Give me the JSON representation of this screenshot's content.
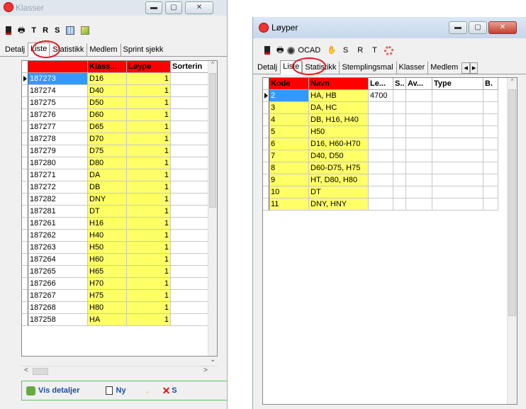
{
  "klasser": {
    "title": "Klasser",
    "toolbar": [
      "T",
      "R",
      "S"
    ],
    "tabs": [
      "Detalj",
      "Liste",
      "Statistikk",
      "Medlem",
      "Sprint sjekk"
    ],
    "columns": [
      "",
      "Klass...",
      "Løype",
      "Sorterin"
    ],
    "rows": [
      [
        "187273",
        "D16",
        "1"
      ],
      [
        "187274",
        "D40",
        "1"
      ],
      [
        "187275",
        "D50",
        "1"
      ],
      [
        "187276",
        "D60",
        "1"
      ],
      [
        "187277",
        "D65",
        "1"
      ],
      [
        "187278",
        "D70",
        "1"
      ],
      [
        "187279",
        "D75",
        "1"
      ],
      [
        "187280",
        "D80",
        "1"
      ],
      [
        "187271",
        "DA",
        "1"
      ],
      [
        "187272",
        "DB",
        "1"
      ],
      [
        "187282",
        "DNY",
        "1"
      ],
      [
        "187281",
        "DT",
        "1"
      ],
      [
        "187261",
        "H16",
        "1"
      ],
      [
        "187262",
        "H40",
        "1"
      ],
      [
        "187263",
        "H50",
        "1"
      ],
      [
        "187264",
        "H60",
        "1"
      ],
      [
        "187265",
        "H65",
        "1"
      ],
      [
        "187266",
        "H70",
        "1"
      ],
      [
        "187267",
        "H75",
        "1"
      ],
      [
        "187268",
        "H80",
        "1"
      ],
      [
        "187258",
        "HA",
        "1"
      ]
    ],
    "buttons": {
      "details": "Vis detaljer",
      "new": "Ny",
      "delete": "S"
    }
  },
  "loyper": {
    "title": "Løyper",
    "toolbar": [
      "OCAD",
      "S",
      "R",
      "T"
    ],
    "tabs": [
      "Detalj",
      "Liste",
      "Statistikk",
      "Stemplingsmal",
      "Klasser",
      "Medlem"
    ],
    "columns": [
      "Kode",
      "Navn",
      "Le...",
      "S..",
      "Av...",
      "Type",
      "B."
    ],
    "rows": [
      [
        "2",
        "HA, HB",
        "4700"
      ],
      [
        "3",
        "DA, HC",
        ""
      ],
      [
        "4",
        "DB, H16, H40",
        ""
      ],
      [
        "5",
        "H50",
        ""
      ],
      [
        "6",
        "D16, H60-H70",
        ""
      ],
      [
        "7",
        "D40, D50",
        ""
      ],
      [
        "8",
        "D60-D75, H75",
        ""
      ],
      [
        "9",
        "HT, D80, H80",
        ""
      ],
      [
        "10",
        "DT",
        ""
      ],
      [
        "11",
        "DNY, HNY",
        ""
      ]
    ]
  }
}
